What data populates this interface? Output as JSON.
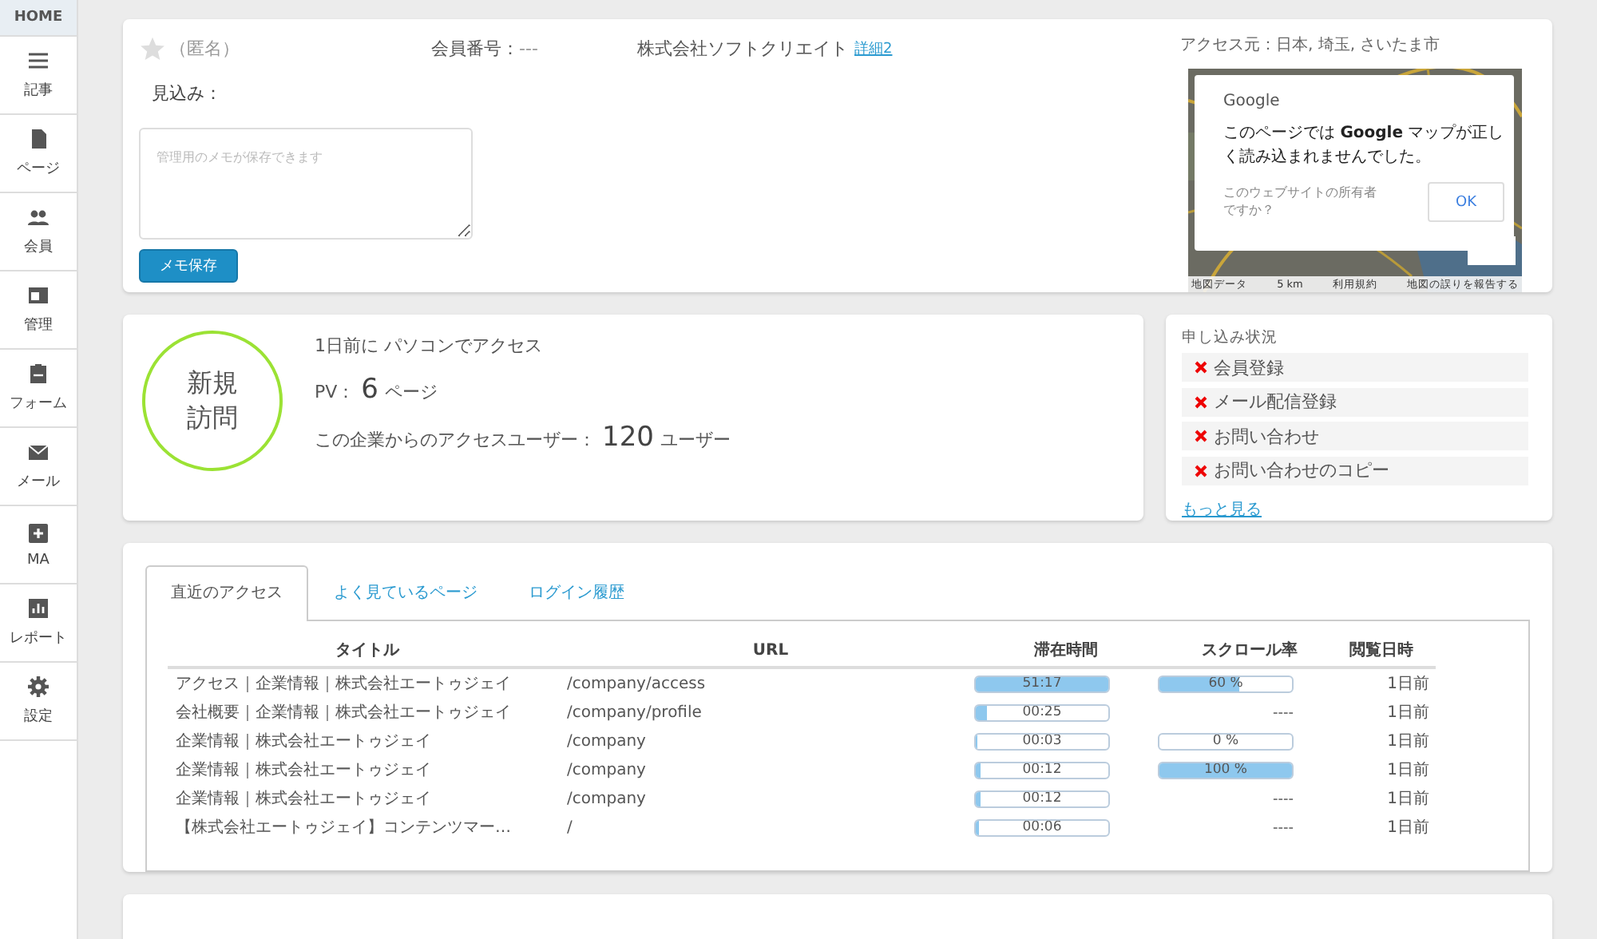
{
  "sidebar": {
    "home": "HOME",
    "items": [
      {
        "label": "記事"
      },
      {
        "label": "ページ"
      },
      {
        "label": "会員"
      },
      {
        "label": "管理"
      },
      {
        "label": "フォーム"
      },
      {
        "label": "メール"
      },
      {
        "label": "MA"
      },
      {
        "label": "レポート"
      },
      {
        "label": "設定"
      }
    ]
  },
  "profile": {
    "starred": false,
    "name": "（匿名）",
    "member_no_label": "会員番号：",
    "member_no": "---",
    "company": "株式会社ソフトクリエイト",
    "detail_link": "詳細2",
    "prospect_label": "見込み：",
    "memo": {
      "placeholder": "管理用のメモが保存できます"
    },
    "save_button": "メモ保存",
    "access_from": "アクセス元：日本, 埼玉, さいたま市",
    "map": {
      "dialog_title": "Google",
      "dialog_message": "このページでは **Google** マップが正しく読み込まれませんでした。",
      "dialog_question": "このウェブサイトの所有者ですか？",
      "dialog_ok": "OK",
      "footer": [
        "地図データ",
        "5 km",
        "利用規約",
        "地図の誤りを報告する"
      ]
    }
  },
  "visit": {
    "badge_line1": "新規",
    "badge_line2": "訪問",
    "last_access": "1日前に パソコンでアクセス",
    "pv_label": "PV：",
    "pv_value": "6",
    "pv_unit": "ページ",
    "users_label": "この企業からのアクセスユーザー：",
    "users_value": "120",
    "users_unit": "ユーザー"
  },
  "applications": {
    "title": "申し込み状況",
    "items": [
      {
        "label": "会員登録",
        "done": false
      },
      {
        "label": "メール配信登録",
        "done": false
      },
      {
        "label": "お問い合わせ",
        "done": false
      },
      {
        "label": "お問い合わせのコピー",
        "done": false
      }
    ],
    "more_link": "もっと見る"
  },
  "tabs": [
    {
      "label": "直近のアクセス",
      "selected": true
    },
    {
      "label": "よく見ているページ",
      "selected": false
    },
    {
      "label": "ログイン履歴",
      "selected": false
    }
  ],
  "table": {
    "columns": [
      "タイトル",
      "URL",
      "滞在時間",
      "スクロール率",
      "閲覧日時"
    ],
    "rows": [
      {
        "title": "アクセス｜企業情報｜株式会社エートゥジェイ",
        "url": "/company/access",
        "time": {
          "text": "51:17",
          "level": 1
        },
        "scroll": {
          "kind": "bar",
          "text": "60 %",
          "level": 0.6
        },
        "viewed": "1日前"
      },
      {
        "title": "会社概要｜企業情報｜株式会社エートゥジェイ",
        "url": "/company/profile",
        "time": {
          "text": "00:25",
          "level": 0.08
        },
        "scroll": {
          "kind": "text",
          "text": "----"
        },
        "viewed": "1日前"
      },
      {
        "title": "企業情報｜株式会社エートゥジェイ",
        "url": "/company",
        "time": {
          "text": "00:03",
          "level": 0.01
        },
        "scroll": {
          "kind": "bar",
          "text": "0 %",
          "level": 0
        },
        "viewed": "1日前"
      },
      {
        "title": "企業情報｜株式会社エートゥジェイ",
        "url": "/company",
        "time": {
          "text": "00:12",
          "level": 0.04
        },
        "scroll": {
          "kind": "bar",
          "text": "100 %",
          "level": 1
        },
        "viewed": "1日前"
      },
      {
        "title": "企業情報｜株式会社エートゥジェイ",
        "url": "/company",
        "time": {
          "text": "00:12",
          "level": 0.04
        },
        "scroll": {
          "kind": "text",
          "text": "----"
        },
        "viewed": "1日前"
      },
      {
        "title": "【株式会社エートゥジェイ】コンテンツマー…",
        "url": "/",
        "time": {
          "text": "00:06",
          "level": 0.02
        },
        "scroll": {
          "kind": "text",
          "text": "----"
        },
        "viewed": "1日前"
      }
    ]
  }
}
